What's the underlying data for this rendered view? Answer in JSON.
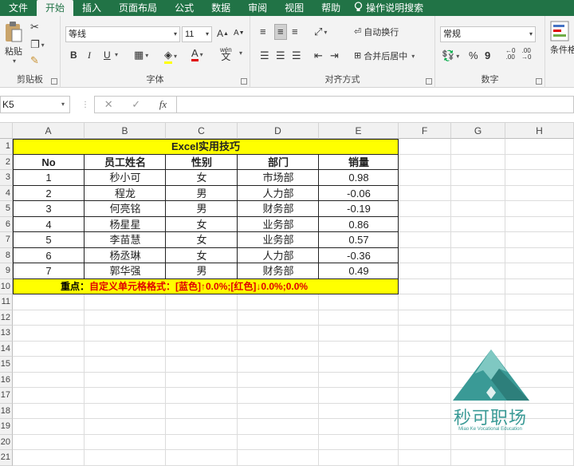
{
  "menu": {
    "tabs": [
      "文件",
      "开始",
      "插入",
      "页面布局",
      "公式",
      "数据",
      "审阅",
      "视图",
      "帮助"
    ],
    "active": "开始",
    "tell_me": "操作说明搜索"
  },
  "ribbon": {
    "clipboard": {
      "paste": "粘贴",
      "label": "剪贴板"
    },
    "font": {
      "name": "等线",
      "size": "11",
      "label": "字体",
      "bold": "B",
      "italic": "I",
      "underline": "U",
      "grow": "A",
      "shrink": "A",
      "font_color": "A",
      "phonetic": "wén"
    },
    "alignment": {
      "wrap": "自动换行",
      "merge": "合并后居中",
      "label": "对齐方式"
    },
    "number": {
      "format": "常规",
      "percent": "%",
      "comma": "9",
      "label": "数字"
    },
    "styles": {
      "conditional": "条件格"
    }
  },
  "formula_bar": {
    "name_box": "K5",
    "cancel": "✕",
    "enter": "✓",
    "fx": "fx",
    "value": ""
  },
  "columns": [
    "A",
    "B",
    "C",
    "D",
    "E",
    "F",
    "G",
    "H"
  ],
  "rows": [
    "1",
    "2",
    "3",
    "4",
    "5",
    "6",
    "7",
    "8",
    "9",
    "10",
    "11",
    "12",
    "13",
    "14",
    "15",
    "16",
    "17",
    "18",
    "19",
    "20",
    "21"
  ],
  "sheet": {
    "title": "Excel实用技巧",
    "headers": [
      "No",
      "员工姓名",
      "性别",
      "部门",
      "销量"
    ],
    "data": [
      [
        "1",
        "秒小可",
        "女",
        "市场部",
        "0.98"
      ],
      [
        "2",
        "程龙",
        "男",
        "人力部",
        "-0.06"
      ],
      [
        "3",
        "何亮铭",
        "男",
        "财务部",
        "-0.19"
      ],
      [
        "4",
        "杨星星",
        "女",
        "业务部",
        "0.86"
      ],
      [
        "5",
        "李苗慧",
        "女",
        "业务部",
        "0.57"
      ],
      [
        "6",
        "杨丞琳",
        "女",
        "人力部",
        "-0.36"
      ],
      [
        "7",
        "郭华强",
        "男",
        "财务部",
        "0.49"
      ]
    ],
    "note_prefix": "重点：",
    "note_body": "自定义单元格格式：[蓝色]↑0.0%;[红色]↓0.0%;0.0%"
  },
  "watermark": {
    "brand": "秒可职场",
    "sub": "Miao Ke Vocational Education"
  },
  "colors": {
    "excel_green": "#217346",
    "highlight": "#ffff00",
    "note_red": "#e00000",
    "logo_teal": "#3a9a96"
  }
}
